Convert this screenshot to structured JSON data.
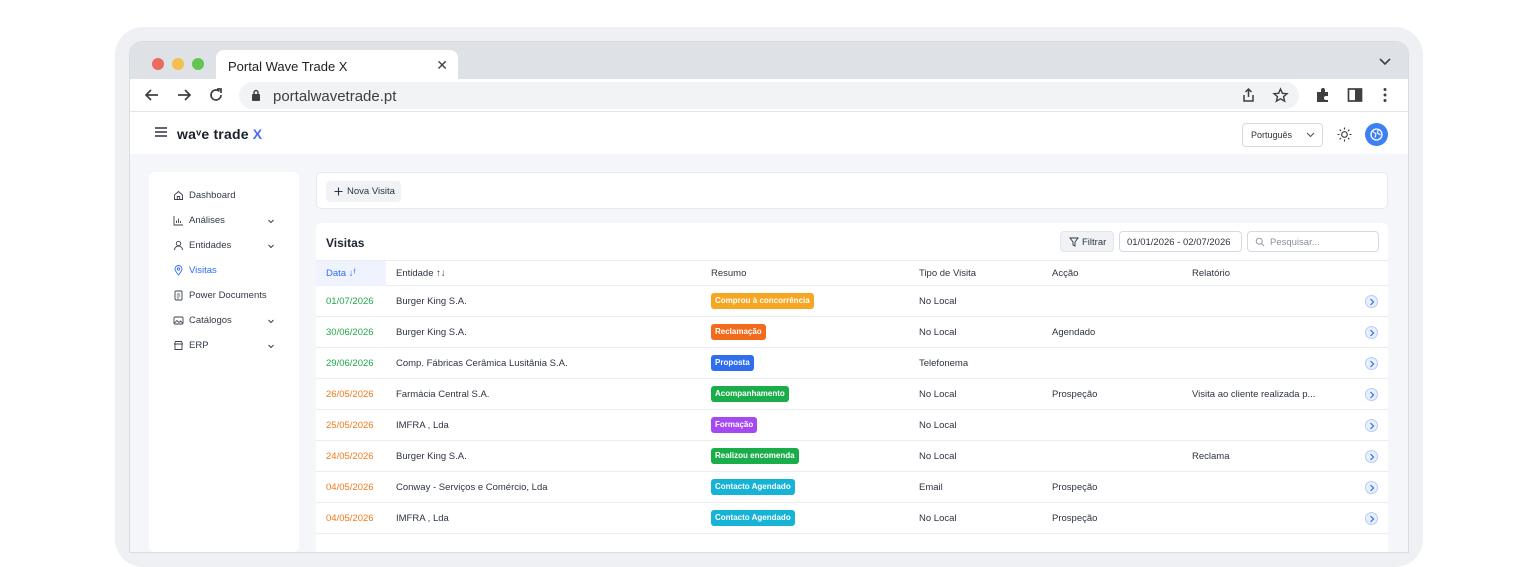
{
  "browser": {
    "tab_title": "Portal Wave Trade X",
    "url": "portalwavetrade.pt"
  },
  "app": {
    "logo_main": "waᵛe trade ",
    "logo_x": "X",
    "language": "Português"
  },
  "sidebar": {
    "items": [
      {
        "label": "Dashboard",
        "icon": "home-icon",
        "has_children": false
      },
      {
        "label": "Análises",
        "icon": "chart-icon",
        "has_children": true
      },
      {
        "label": "Entidades",
        "icon": "user-icon",
        "has_children": true
      },
      {
        "label": "Visitas",
        "icon": "location-pin-icon",
        "has_children": false,
        "active": true
      },
      {
        "label": "Power Documents",
        "icon": "document-icon",
        "has_children": false
      },
      {
        "label": "Catálogos",
        "icon": "image-icon",
        "has_children": true
      },
      {
        "label": "ERP",
        "icon": "store-icon",
        "has_children": true
      }
    ]
  },
  "toolbar": {
    "new_visit_label": "Nova Visita"
  },
  "visits": {
    "title": "Visitas",
    "filter_label": "Filtrar",
    "date_range": "01/01/2026 - 02/07/2026",
    "search_placeholder": "Pesquisar...",
    "columns": {
      "date": "Data",
      "entity": "Entidade",
      "summary": "Resumo",
      "type": "Tipo de Visita",
      "action": "Acção",
      "report": "Relatório"
    },
    "rows": [
      {
        "date": "01/07/2026",
        "date_color": "green",
        "entity": "Burger King S.A.",
        "summary": "Comprou à concorrência",
        "badge_color": "#f5a623",
        "type": "No Local",
        "action": "",
        "report": ""
      },
      {
        "date": "30/06/2026",
        "date_color": "green",
        "entity": "Burger King S.A.",
        "summary": "Reclamação",
        "badge_color": "#f26a1b",
        "type": "No Local",
        "action": "Agendado",
        "report": ""
      },
      {
        "date": "29/06/2026",
        "date_color": "green",
        "entity": "Comp. Fábricas Cerâmica Lusitânia S.A.",
        "summary": "Proposta",
        "badge_color": "#2f6fef",
        "type": "Telefonema",
        "action": "",
        "report": ""
      },
      {
        "date": "26/05/2026",
        "date_color": "orange",
        "entity": "Farmácia Central S.A.",
        "summary": "Acompanhamento",
        "badge_color": "#1aae4a",
        "type": "No Local",
        "action": "Prospeção",
        "report": "Visita ao cliente realizada p..."
      },
      {
        "date": "25/05/2026",
        "date_color": "orange",
        "entity": "IMFRA , Lda",
        "summary": "Formação",
        "badge_color": "#a54af0",
        "type": "No Local",
        "action": "",
        "report": ""
      },
      {
        "date": "24/05/2026",
        "date_color": "orange",
        "entity": "Burger King S.A.",
        "summary": "Realizou encomenda",
        "badge_color": "#1aae4a",
        "type": "No Local",
        "action": "",
        "report": "Reclama"
      },
      {
        "date": "04/05/2026",
        "date_color": "orange",
        "entity": "Conway - Serviços e Comércio, Lda",
        "summary": "Contacto Agendado",
        "badge_color": "#15b3d6",
        "type": "Email",
        "action": "Prospeção",
        "report": ""
      },
      {
        "date": "04/05/2026",
        "date_color": "orange",
        "entity": "IMFRA , Lda",
        "summary": "Contacto Agendado",
        "badge_color": "#15b3d6",
        "type": "No Local",
        "action": "Prospeção",
        "report": ""
      }
    ]
  }
}
